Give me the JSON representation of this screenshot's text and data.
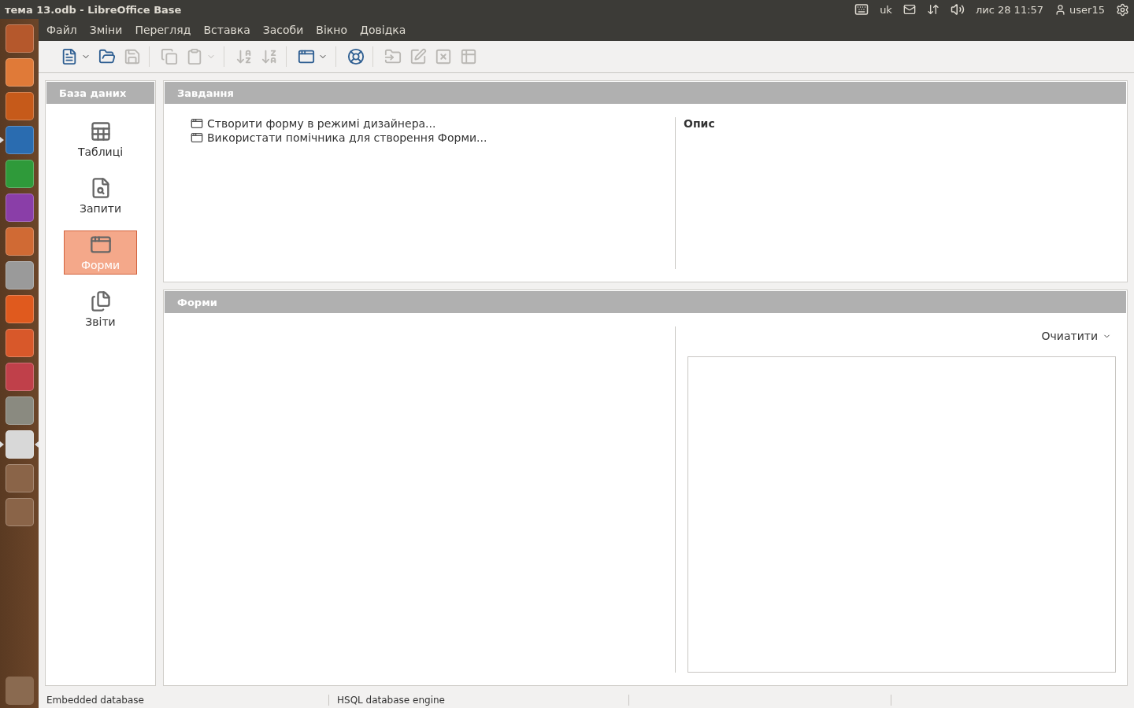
{
  "top_panel": {
    "title": "тема 13.odb - LibreOffice Base",
    "keyboard": "uk",
    "clock": "лис 28 11:57",
    "user": "user15"
  },
  "launcher": [
    {
      "running": false,
      "focused": false
    },
    {
      "running": false,
      "focused": false
    },
    {
      "running": false,
      "focused": false
    },
    {
      "running": true,
      "focused": false
    },
    {
      "running": false,
      "focused": false
    },
    {
      "running": false,
      "focused": false
    },
    {
      "running": false,
      "focused": false
    },
    {
      "running": false,
      "focused": false
    },
    {
      "running": false,
      "focused": false
    },
    {
      "running": false,
      "focused": false
    },
    {
      "running": false,
      "focused": false
    },
    {
      "running": false,
      "focused": false
    },
    {
      "running": true,
      "focused": true
    },
    {
      "running": false,
      "focused": false
    },
    {
      "running": false,
      "focused": false
    }
  ],
  "menu": [
    "Файл",
    "Зміни",
    "Перегляд",
    "Вставка",
    "Засоби",
    "Вікно",
    "Довідка"
  ],
  "toolbar": [
    [
      {
        "disabled": false,
        "dropdown": true
      },
      {
        "disabled": false,
        "dropdown": false
      },
      {
        "disabled": true,
        "dropdown": false
      }
    ],
    [
      {
        "disabled": true,
        "dropdown": false
      },
      {
        "disabled": true,
        "dropdown": true
      }
    ],
    [
      {
        "disabled": true,
        "dropdown": false
      },
      {
        "disabled": true,
        "dropdown": false
      }
    ],
    [
      {
        "disabled": false,
        "dropdown": true
      }
    ],
    [
      {
        "disabled": false,
        "dropdown": false
      }
    ],
    [
      {
        "disabled": true,
        "dropdown": false
      },
      {
        "disabled": true,
        "dropdown": false
      },
      {
        "disabled": true,
        "dropdown": false
      },
      {
        "disabled": true,
        "dropdown": false
      }
    ]
  ],
  "database_panel": {
    "title": "База даних",
    "items": [
      {
        "label": "Таблиці",
        "selected": false
      },
      {
        "label": "Запити",
        "selected": false
      },
      {
        "label": "Форми",
        "selected": true
      },
      {
        "label": "Звіти",
        "selected": false
      }
    ]
  },
  "tasks_panel": {
    "title": "Завдання",
    "tasks": [
      "Створити форму в режимі дизайнера...",
      "Використати помічника для створення Форми..."
    ],
    "description_title": "Опис"
  },
  "forms_panel": {
    "title": "Форми",
    "preview_menu": "Очиатити"
  },
  "status_bar": [
    "Embedded database",
    "HSQL database engine"
  ]
}
